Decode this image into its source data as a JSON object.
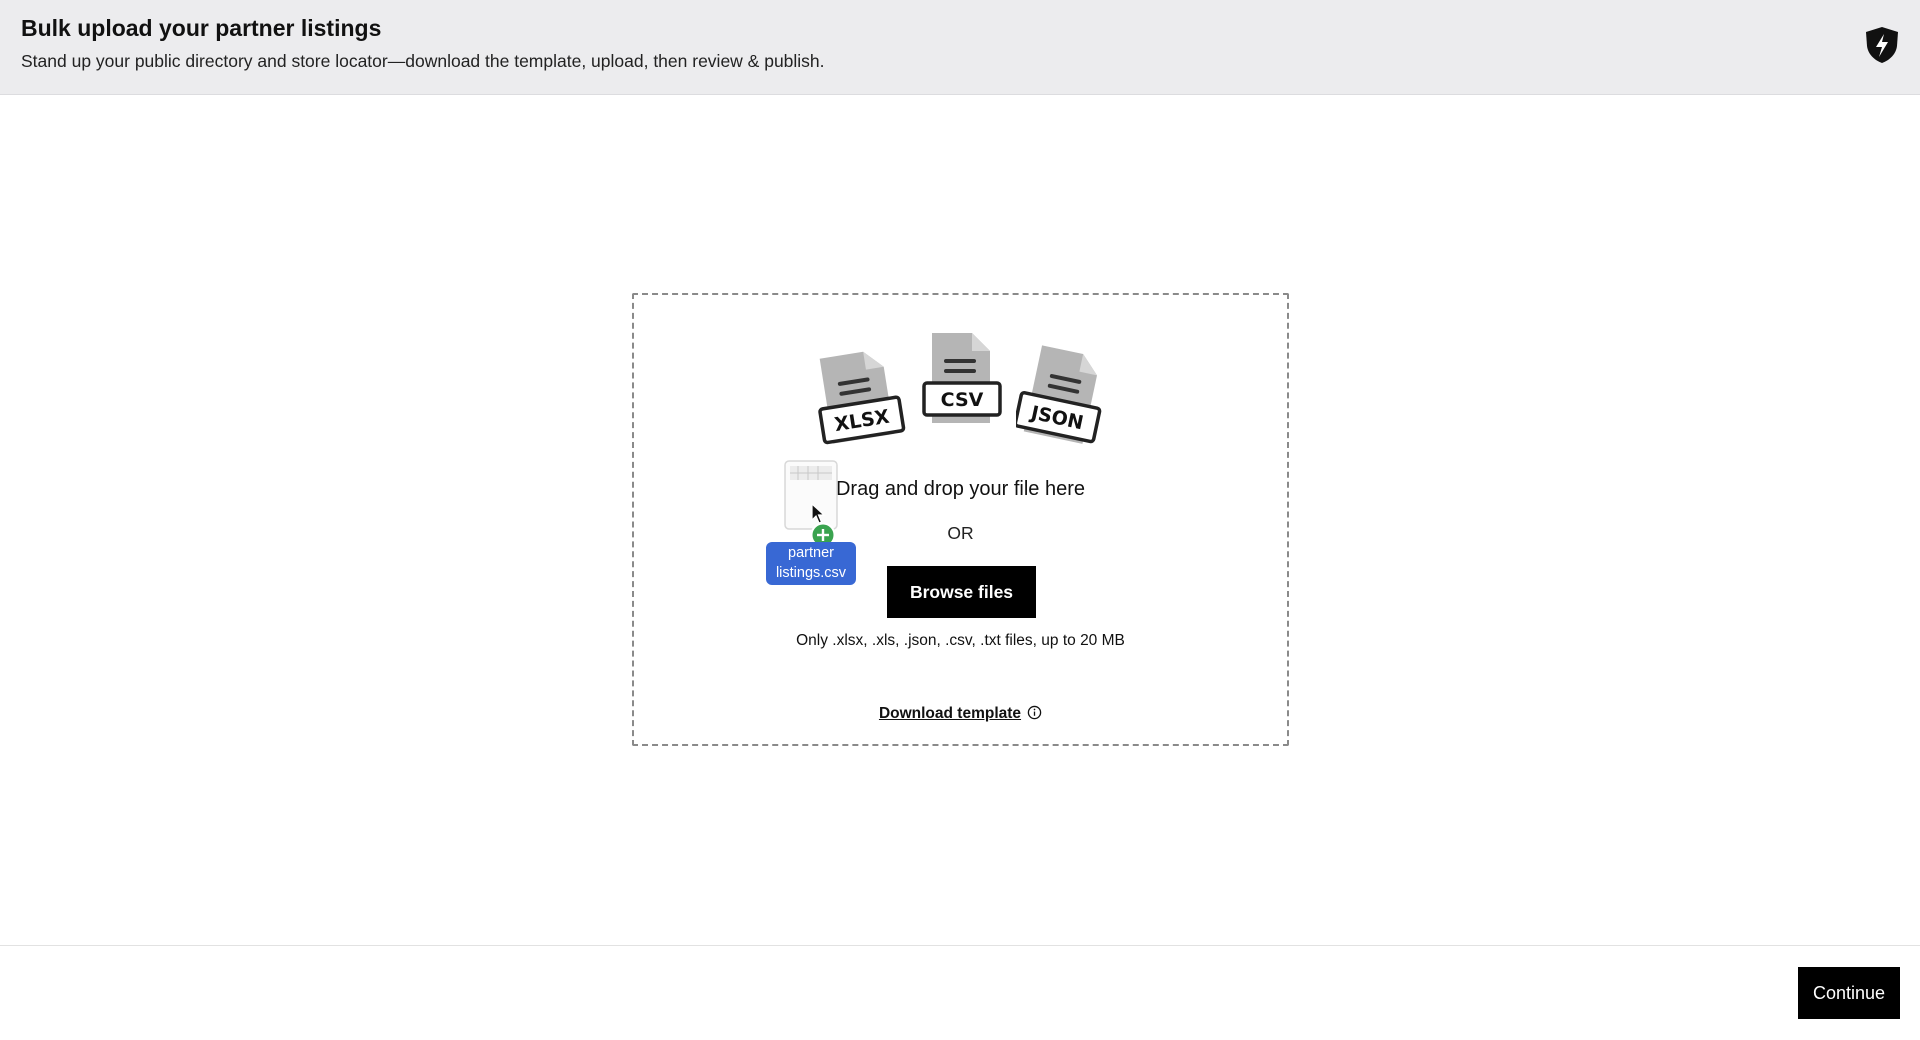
{
  "header": {
    "title": "Bulk upload your partner listings",
    "subtitle": "Stand up your public directory and store locator—download the template, upload, then review & publish."
  },
  "dropzone": {
    "file_types": [
      {
        "label": "XLSX",
        "icon": "xlsx-file-icon"
      },
      {
        "label": "CSV",
        "icon": "csv-file-icon"
      },
      {
        "label": "JSON",
        "icon": "json-file-icon"
      }
    ],
    "title": "Drag and drop your file here",
    "or_text": "OR",
    "browse_label": "Browse files",
    "hint": "Only .xlsx, .xls, .json, .csv, .txt files, up to 20 MB",
    "template_link": "Download template"
  },
  "drag_ghost": {
    "file_name": "partner listings.csv"
  },
  "footer": {
    "continue_label": "Continue"
  },
  "colors": {
    "header_bg": "#ececee",
    "button_bg": "#000000",
    "drag_label_bg": "#3868d4",
    "plus_badge": "#3aa34f",
    "file_icon_gray": "#b5b5b5"
  }
}
